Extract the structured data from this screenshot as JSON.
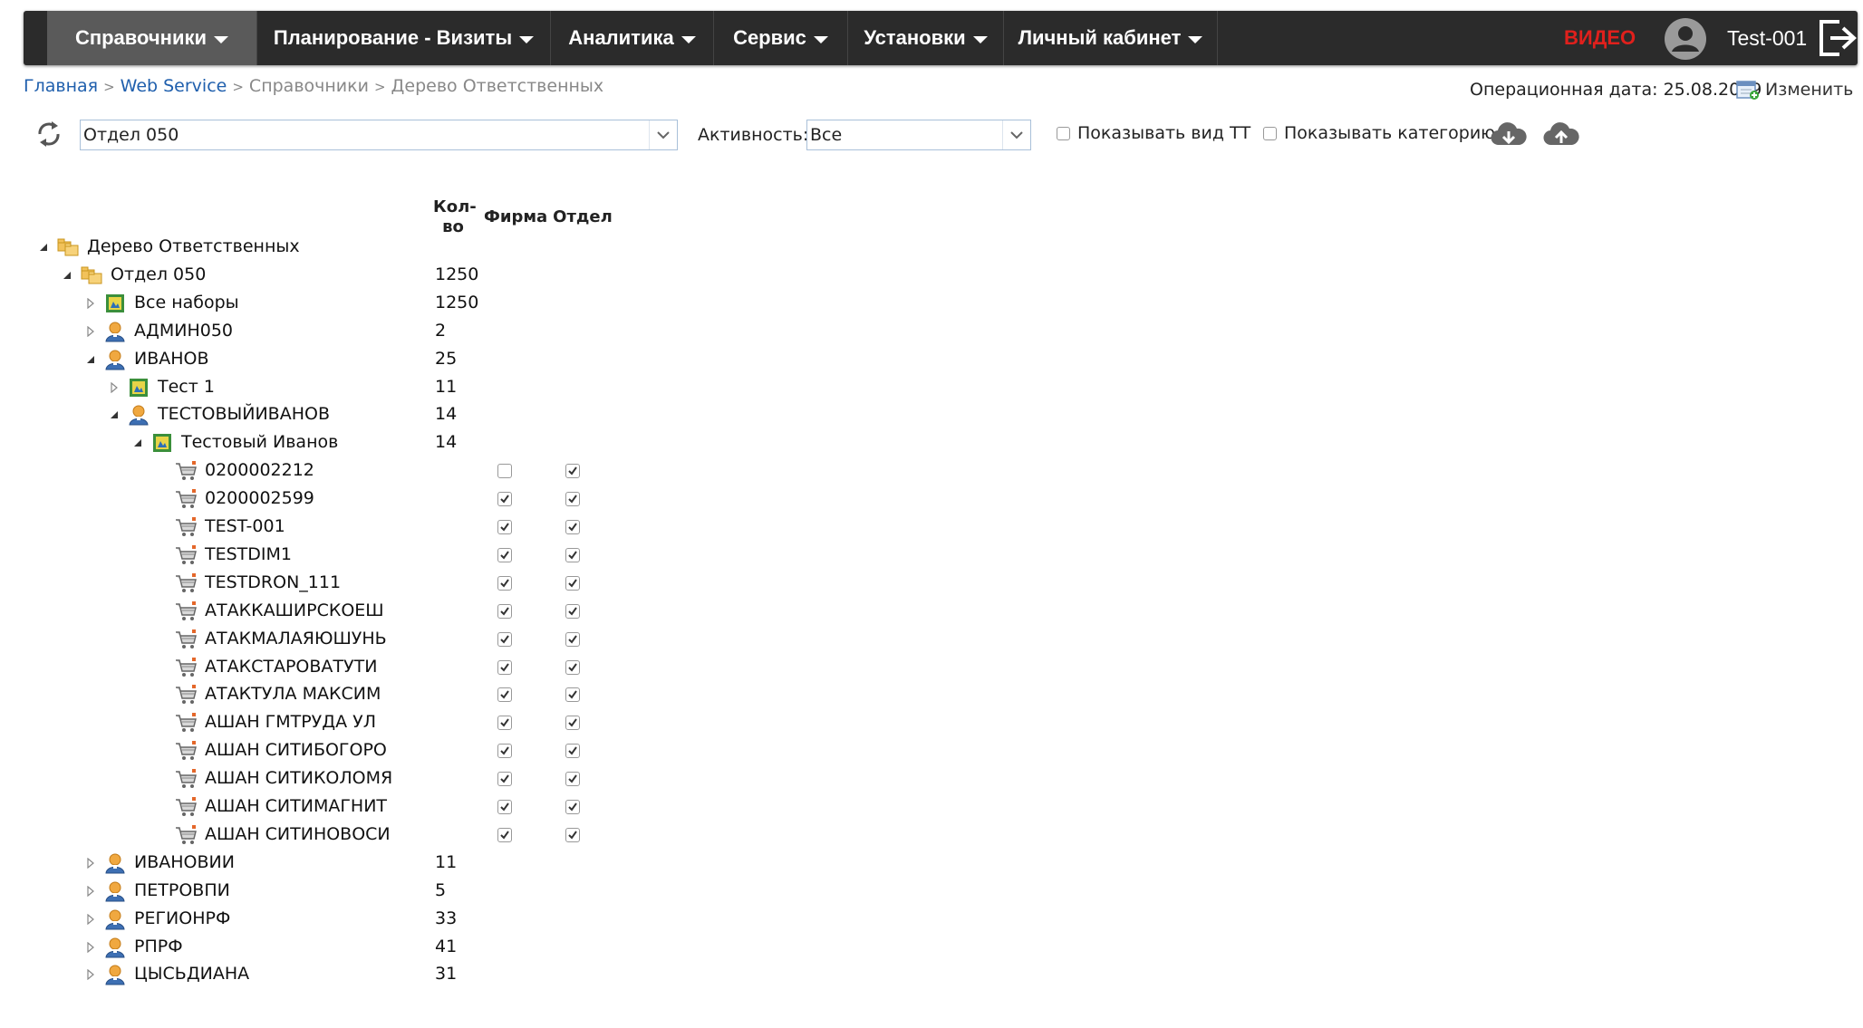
{
  "nav": {
    "items": [
      {
        "label": "Справочники"
      },
      {
        "label": "Планирование - Визиты"
      },
      {
        "label": "Аналитика"
      },
      {
        "label": "Сервис"
      },
      {
        "label": "Установки"
      },
      {
        "label": "Личный кабинет"
      }
    ],
    "video_label": "ВИДЕО",
    "username": "Test-001"
  },
  "breadcrumb": {
    "home": "Главная",
    "web_service": "Web Service",
    "references": "Справочники",
    "current": "Дерево Ответственных"
  },
  "header": {
    "opdate_text": "Операционная дата: 25.08.2019",
    "edit_label": "Изменить"
  },
  "filters": {
    "department_value": "Отдел 050",
    "activity_label": "Активность:",
    "activity_value": "Все",
    "show_tt_type_label": "Показывать вид ТТ",
    "show_tt_type_checked": false,
    "show_category_label": "Показывать категорию",
    "show_category_checked": false
  },
  "columns": {
    "count_line1": "Кол-",
    "count_line2": "во",
    "firm": "Фирма",
    "department": "Отдел"
  },
  "tree": [
    {
      "level": 0,
      "expanded": true,
      "icon": "folder-icon",
      "label": "Дерево Ответственных",
      "count": ""
    },
    {
      "level": 1,
      "expanded": true,
      "icon": "folder-icon",
      "label": "Отдел 050",
      "count": "1250"
    },
    {
      "level": 2,
      "expanded": false,
      "icon": "set-icon",
      "label": "Все наборы",
      "count": "1250"
    },
    {
      "level": 2,
      "expanded": false,
      "icon": "user-icon",
      "label": "АДМИН050",
      "count": "2"
    },
    {
      "level": 2,
      "expanded": true,
      "icon": "user-icon",
      "label": "ИВАНОВ",
      "count": "25"
    },
    {
      "level": 3,
      "expanded": false,
      "icon": "set-icon",
      "label": "Тест 1",
      "count": "11"
    },
    {
      "level": 3,
      "expanded": true,
      "icon": "user-icon",
      "label": "ТЕСТОВЫЙИВАНОВ",
      "count": "14"
    },
    {
      "level": 4,
      "expanded": true,
      "icon": "set-icon",
      "label": "Тестовый Иванов",
      "count": "14"
    },
    {
      "level": 5,
      "leaf": true,
      "icon": "cart-icon",
      "label": "0200002212",
      "count": "",
      "firm": false,
      "dept": true
    },
    {
      "level": 5,
      "leaf": true,
      "icon": "cart-icon",
      "label": "0200002599",
      "count": "",
      "firm": true,
      "dept": true
    },
    {
      "level": 5,
      "leaf": true,
      "icon": "cart-icon",
      "label": "TEST-001",
      "count": "",
      "firm": true,
      "dept": true
    },
    {
      "level": 5,
      "leaf": true,
      "icon": "cart-icon",
      "label": "TESTDIM1",
      "count": "",
      "firm": true,
      "dept": true
    },
    {
      "level": 5,
      "leaf": true,
      "icon": "cart-icon",
      "label": "TESTDRON_111",
      "count": "",
      "firm": true,
      "dept": true
    },
    {
      "level": 5,
      "leaf": true,
      "icon": "cart-icon",
      "label": "АТАККАШИРСКОЕШ",
      "count": "",
      "firm": true,
      "dept": true
    },
    {
      "level": 5,
      "leaf": true,
      "icon": "cart-icon",
      "label": "АТАКМАЛАЯЮШУНЬ",
      "count": "",
      "firm": true,
      "dept": true
    },
    {
      "level": 5,
      "leaf": true,
      "icon": "cart-icon",
      "label": "АТАКСТАРОВАТУТИ",
      "count": "",
      "firm": true,
      "dept": true
    },
    {
      "level": 5,
      "leaf": true,
      "icon": "cart-icon",
      "label": "АТАКТУЛА МАКСИМ",
      "count": "",
      "firm": true,
      "dept": true
    },
    {
      "level": 5,
      "leaf": true,
      "icon": "cart-icon",
      "label": "АШАН ГМТРУДА УЛ",
      "count": "",
      "firm": true,
      "dept": true
    },
    {
      "level": 5,
      "leaf": true,
      "icon": "cart-icon",
      "label": "АШАН СИТИБОГОРО",
      "count": "",
      "firm": true,
      "dept": true
    },
    {
      "level": 5,
      "leaf": true,
      "icon": "cart-icon",
      "label": "АШАН СИТИКОЛОМЯ",
      "count": "",
      "firm": true,
      "dept": true
    },
    {
      "level": 5,
      "leaf": true,
      "icon": "cart-icon",
      "label": "АШАН СИТИМАГНИТ",
      "count": "",
      "firm": true,
      "dept": true
    },
    {
      "level": 5,
      "leaf": true,
      "icon": "cart-icon",
      "label": "АШАН СИТИНОВОСИ",
      "count": "",
      "firm": true,
      "dept": true
    },
    {
      "level": 2,
      "expanded": false,
      "icon": "user-icon",
      "label": "ИВАНОВИИ",
      "count": "11"
    },
    {
      "level": 2,
      "expanded": false,
      "icon": "user-icon",
      "label": "ПЕТРОВПИ",
      "count": "5"
    },
    {
      "level": 2,
      "expanded": false,
      "icon": "user-icon",
      "label": "РЕГИОНРФ",
      "count": "33"
    },
    {
      "level": 2,
      "expanded": false,
      "icon": "user-icon",
      "label": "РПРФ",
      "count": "41"
    },
    {
      "level": 2,
      "expanded": false,
      "icon": "user-icon",
      "label": "ЦЫСЬДИАНА",
      "count": "31"
    }
  ]
}
